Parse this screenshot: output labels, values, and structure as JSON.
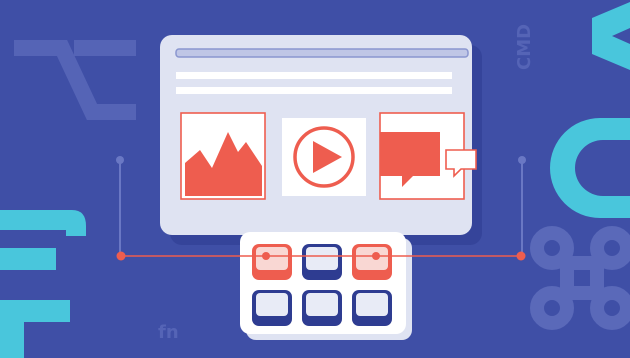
{
  "scene": {
    "background_color": "#3f4fa6",
    "accent_color": "#ee5d4f",
    "cyan_color": "#49c6dc",
    "window_color": "#dfe3f2",
    "key_color": "#ffffff",
    "key_shadow_color": "#2e3c91"
  },
  "key_glyphs": {
    "cmd": "CMD",
    "fn": "fn"
  },
  "window": {
    "panels": [
      {
        "name": "image-panel",
        "icon": "image-icon"
      },
      {
        "name": "video-panel",
        "icon": "play-icon"
      },
      {
        "name": "chat-panel",
        "icon": "chat-bubbles-icon"
      }
    ]
  },
  "keypad": {
    "rows": 2,
    "cols": 3,
    "highlighted_keys": [
      0,
      2
    ]
  },
  "symbols": {
    "left": [
      "option-key-icon",
      "function-f-icon"
    ],
    "right": [
      "command-key-icon",
      "cv-letters"
    ]
  }
}
